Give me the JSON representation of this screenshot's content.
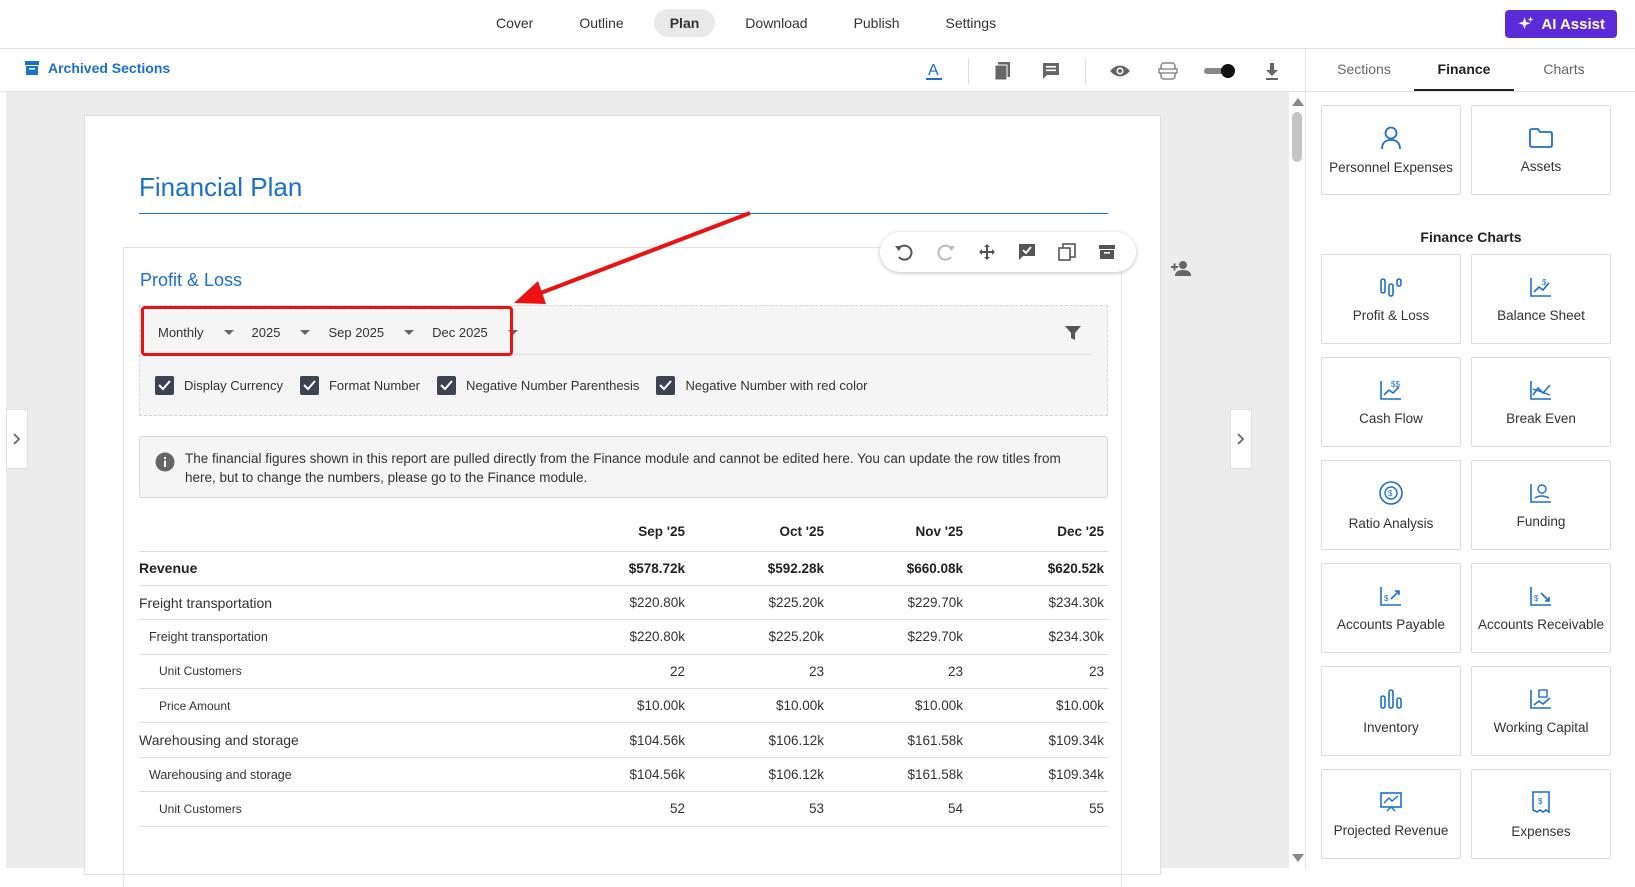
{
  "topnav": {
    "tabs": [
      {
        "label": "Cover"
      },
      {
        "label": "Outline"
      },
      {
        "label": "Plan",
        "active": true
      },
      {
        "label": "Download"
      },
      {
        "label": "Publish"
      },
      {
        "label": "Settings"
      }
    ],
    "ai_button": "AI Assist"
  },
  "subbar": {
    "archived_label": "Archived Sections"
  },
  "document": {
    "title": "Financial Plan",
    "section_title": "Profit & Loss",
    "filters": {
      "period": "Monthly",
      "year": "2025",
      "start": "Sep 2025",
      "end": "Dec 2025"
    },
    "checkboxes": [
      {
        "label": "Display Currency",
        "checked": true
      },
      {
        "label": "Format Number",
        "checked": true
      },
      {
        "label": "Negative Number Parenthesis",
        "checked": true
      },
      {
        "label": "Negative Number with red color",
        "checked": true
      }
    ],
    "info_text": "The financial figures shown in this report are pulled directly from the Finance module and cannot be edited here. You can update the row titles from here, but to change the numbers, please go to the Finance module.",
    "table": {
      "columns": [
        "",
        "Sep '25",
        "Oct '25",
        "Nov '25",
        "Dec '25"
      ],
      "rows": [
        {
          "level": 0,
          "label": "Revenue",
          "values": [
            "$578.72k",
            "$592.28k",
            "$660.08k",
            "$620.52k"
          ]
        },
        {
          "level": 1,
          "label": "Freight transportation",
          "values": [
            "$220.80k",
            "$225.20k",
            "$229.70k",
            "$234.30k"
          ]
        },
        {
          "level": 2,
          "label": "Freight transportation",
          "values": [
            "$220.80k",
            "$225.20k",
            "$229.70k",
            "$234.30k"
          ]
        },
        {
          "level": 3,
          "label": "Unit Customers",
          "values": [
            "22",
            "23",
            "23",
            "23"
          ]
        },
        {
          "level": 3,
          "label": "Price Amount",
          "values": [
            "$10.00k",
            "$10.00k",
            "$10.00k",
            "$10.00k"
          ]
        },
        {
          "level": 1,
          "label": "Warehousing and storage",
          "values": [
            "$104.56k",
            "$106.12k",
            "$161.58k",
            "$109.34k"
          ]
        },
        {
          "level": 2,
          "label": "Warehousing and storage",
          "values": [
            "$104.56k",
            "$106.12k",
            "$161.58k",
            "$109.34k"
          ]
        },
        {
          "level": 3,
          "label": "Unit Customers",
          "values": [
            "52",
            "53",
            "54",
            "55"
          ]
        }
      ]
    }
  },
  "rightpanel": {
    "tabs": [
      {
        "label": "Sections"
      },
      {
        "label": "Finance",
        "active": true
      },
      {
        "label": "Charts"
      }
    ],
    "top_cards": [
      {
        "label": "Personnel Expenses",
        "icon": "person-icon"
      },
      {
        "label": "Assets",
        "icon": "folder-icon"
      }
    ],
    "charts_title": "Finance Charts",
    "chart_cards": [
      {
        "label": "Profit & Loss",
        "icon": "bars-icon"
      },
      {
        "label": "Balance Sheet",
        "icon": "chart-dollar-icon"
      },
      {
        "label": "Cash Flow",
        "icon": "cash-flow-icon"
      },
      {
        "label": "Break Even",
        "icon": "break-even-icon"
      },
      {
        "label": "Ratio Analysis",
        "icon": "ratio-icon"
      },
      {
        "label": "Funding",
        "icon": "funding-icon"
      },
      {
        "label": "Accounts Payable",
        "icon": "payable-icon"
      },
      {
        "label": "Accounts Receivable",
        "icon": "receivable-icon"
      },
      {
        "label": "Inventory",
        "icon": "inventory-icon"
      },
      {
        "label": "Working Capital",
        "icon": "working-capital-icon"
      },
      {
        "label": "Projected Revenue",
        "icon": "projected-revenue-icon"
      },
      {
        "label": "Expenses",
        "icon": "expenses-icon"
      }
    ]
  },
  "colors": {
    "accent": "#1a6fd1",
    "ai_button": "#5b2bd9",
    "highlight": "#ee1111"
  }
}
